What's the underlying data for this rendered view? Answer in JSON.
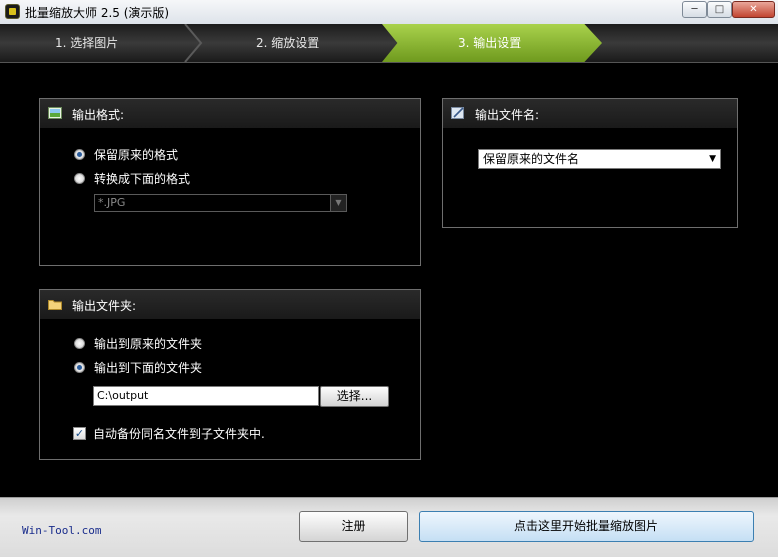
{
  "window": {
    "title": "批量缩放大师 2.5 (演示版)",
    "controls": {
      "minimize": "─",
      "maximize": "□",
      "close": "✕"
    }
  },
  "steps": [
    {
      "label": "1. 选择图片",
      "active": false
    },
    {
      "label": "2. 缩放设置",
      "active": false
    },
    {
      "label": "3. 输出设置",
      "active": true
    }
  ],
  "output_format": {
    "title": "输出格式:",
    "options": [
      {
        "label": "保留原来的格式",
        "selected": true
      },
      {
        "label": "转换成下面的格式",
        "selected": false
      }
    ],
    "format_select": {
      "value": "*.JPG",
      "enabled": false
    }
  },
  "output_filename": {
    "title": "输出文件名:",
    "select_value": "保留原来的文件名"
  },
  "output_folder": {
    "title": "输出文件夹:",
    "options": [
      {
        "label": "输出到原来的文件夹",
        "selected": false
      },
      {
        "label": "输出到下面的文件夹",
        "selected": true
      }
    ],
    "path_value": "C:\\output",
    "browse_label": "选择...",
    "backup_checkbox": {
      "label": "自动备份同名文件到子文件夹中.",
      "checked": true
    }
  },
  "footer": {
    "site": "Win-Tool.com",
    "register_label": "注册",
    "start_label": "点击这里开始批量缩放图片"
  },
  "colors": {
    "accent_green": "#8fbf2f",
    "background": "#000000",
    "link_blue": "#1a2d8c"
  }
}
